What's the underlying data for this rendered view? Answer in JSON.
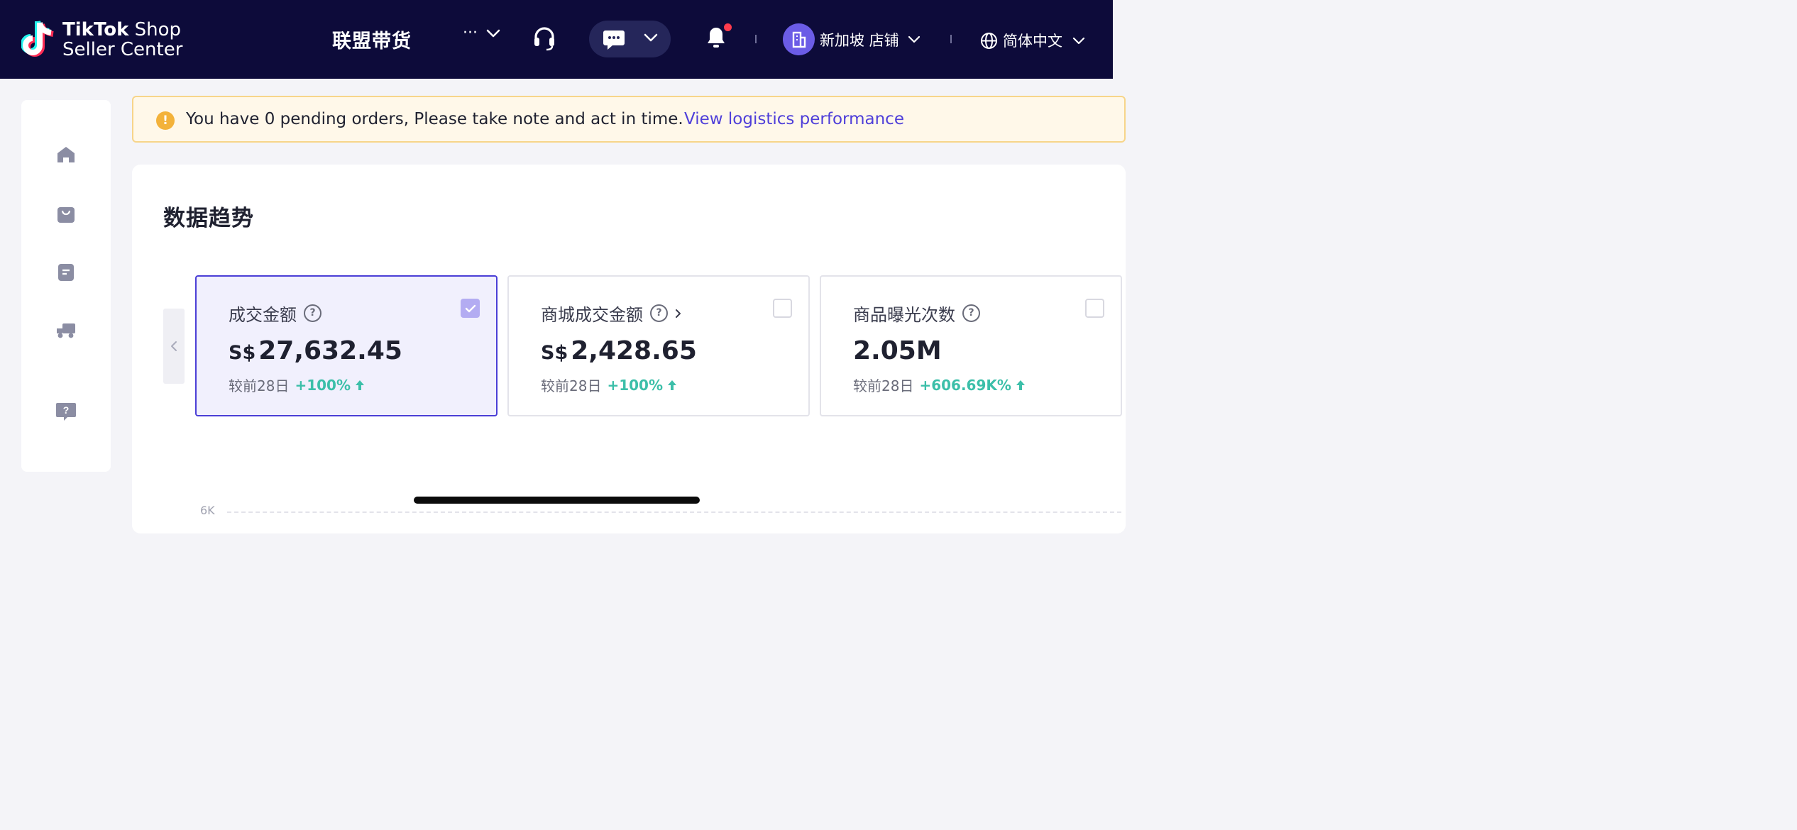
{
  "header": {
    "logo_line1_bold": "TikTok",
    "logo_line1_light": "Shop",
    "logo_line2": "Seller Center",
    "nav_title": "联盟带货",
    "more_label": "···",
    "store_name": "新加坡 店铺",
    "language": "简体中文",
    "notification_dot_color": "#ff3b4d"
  },
  "sidebar": {
    "items": [
      "home-icon",
      "shopping-bag-icon",
      "orders-icon",
      "delivery-truck-icon",
      "help-icon"
    ]
  },
  "alert": {
    "message": "You have 0 pending orders, Please take note and act in time.",
    "link": "View logistics performance"
  },
  "trends": {
    "title": "数据趋势",
    "metrics": [
      {
        "label": "成交金额",
        "currency": "S$",
        "value": "27,632.45",
        "compare_label": "较前28日",
        "change": "+100%",
        "selected": true
      },
      {
        "label": "商城成交金额",
        "currency": "S$",
        "value": "2,428.65",
        "compare_label": "较前28日",
        "change": "+100%",
        "selected": false
      },
      {
        "label": "商品曝光次数",
        "currency": "",
        "value": "2.05M",
        "compare_label": "较前28日",
        "change": "+606.69K%",
        "selected": false
      }
    ],
    "axis_top_label": "6K"
  },
  "colors": {
    "header_bg": "#0d0b3a",
    "accent": "#4b3fd6",
    "positive": "#3cbfa9",
    "alert_bg": "#fff8e9"
  }
}
